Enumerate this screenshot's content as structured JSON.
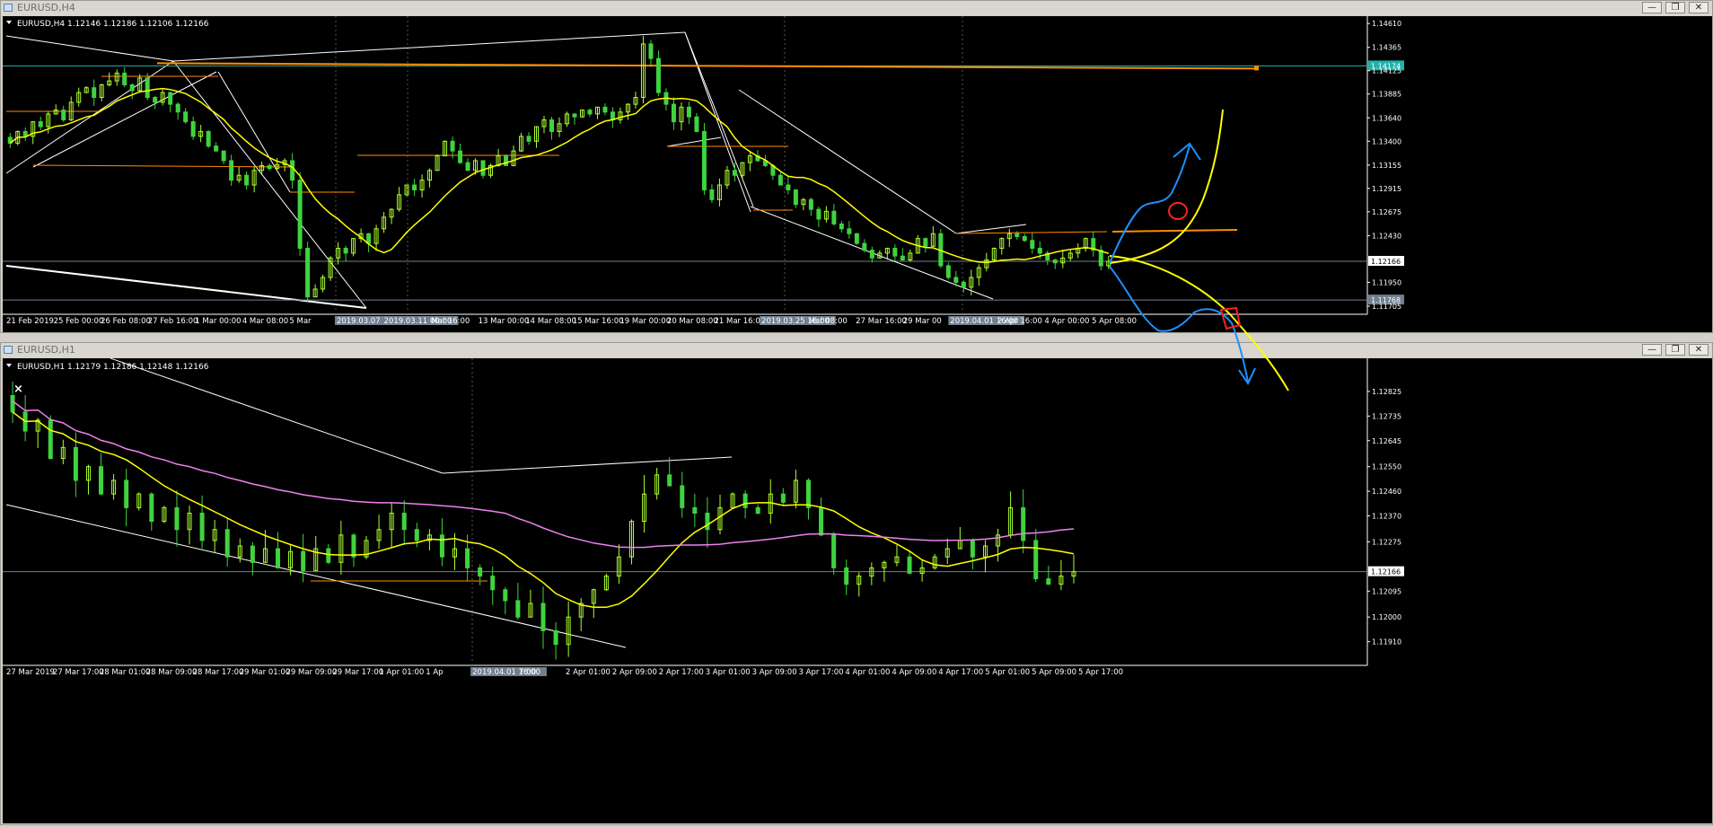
{
  "window_h4": {
    "title": "EURUSD,H4",
    "info": "EURUSD,H4  1.12146 1.12186 1.12106 1.12166",
    "buttons": [
      "—",
      "❐",
      "✕"
    ]
  },
  "window_h1": {
    "title": "EURUSD,H1",
    "info": "EURUSD,H1  1.12179 1.12186 1.12148 1.12166",
    "buttons": [
      "—",
      "❐",
      "✕"
    ]
  },
  "colors": {
    "background": "#000000",
    "bull_candle": "#adff2f",
    "bear_candle": "#3fd33f",
    "ma_yellow": "#ffff00",
    "ma_violet": "#ee82ee",
    "trendline": "#ffffff",
    "level_orange": "#ff8c00",
    "current_price_line": "#708090",
    "sketch_blue": "#1e90ff",
    "sketch_red": "#ff2020"
  },
  "chart_data": [
    {
      "type": "candlestick",
      "symbol": "EURUSD",
      "timeframe": "H4",
      "ohlc": {
        "open": 1.12146,
        "high": 1.12186,
        "low": 1.12106,
        "close": 1.12166
      },
      "ylim": [
        1.1164,
        1.1463
      ],
      "y_ticks": [
        "1.14610",
        "1.14365",
        "1.14174",
        "1.14125",
        "1.13885",
        "1.13640",
        "1.13400",
        "1.13155",
        "1.12915",
        "1.12675",
        "1.12430",
        "1.12166",
        "1.11950",
        "1.11768",
        "1.11705"
      ],
      "current_price": "1.12166",
      "marked_level": "1.14174",
      "lower_level": "1.11768",
      "x_ticks": [
        "21 Feb 2019",
        "25 Feb 00:00",
        "26 Feb 08:00",
        "27 Feb 16:00",
        "1 Mar 00:00",
        "4 Mar 08:00",
        "5 Mar",
        "2019.03.07 00:00",
        "2019.03.11 00:00",
        "Mar 16:00",
        "13 Mar 00:00",
        "14 Mar 08:00",
        "15 Mar 16:00",
        "19 Mar 00:00",
        "20 Mar 08:00",
        "21 Mar 16:00",
        "2019.03.25 16:00",
        "Mar 08:00",
        "27 Mar 16:00",
        "29 Mar 00",
        "2019.04.01 16:00",
        "2 Apr 16:00",
        "4 Apr 00:00",
        "5 Apr 08:00"
      ],
      "highlighted_x_ticks": [
        "2019.03.07 00:00",
        "2019.03.11 00:00",
        "2019.03.25 16:00",
        "2019.04.01 16:00"
      ],
      "closes": [
        1.1338,
        1.135,
        1.1345,
        1.136,
        1.1355,
        1.1368,
        1.1372,
        1.1362,
        1.138,
        1.139,
        1.1395,
        1.1385,
        1.1398,
        1.1402,
        1.141,
        1.1398,
        1.1392,
        1.1405,
        1.1385,
        1.138,
        1.139,
        1.1378,
        1.137,
        1.136,
        1.1345,
        1.135,
        1.1335,
        1.133,
        1.132,
        1.13,
        1.1305,
        1.1295,
        1.131,
        1.1315,
        1.1312,
        1.1316,
        1.132,
        1.13,
        1.123,
        1.118,
        1.1188,
        1.12,
        1.122,
        1.123,
        1.1225,
        1.124,
        1.1245,
        1.1235,
        1.125,
        1.1262,
        1.127,
        1.1285,
        1.1295,
        1.129,
        1.13,
        1.131,
        1.1325,
        1.134,
        1.133,
        1.1318,
        1.131,
        1.132,
        1.1305,
        1.1315,
        1.1325,
        1.1315,
        1.133,
        1.1345,
        1.134,
        1.1355,
        1.1362,
        1.135,
        1.1358,
        1.1368,
        1.1365,
        1.1372,
        1.1368,
        1.1375,
        1.137,
        1.1362,
        1.137,
        1.1378,
        1.1385,
        1.144,
        1.1425,
        1.139,
        1.1378,
        1.136,
        1.1375,
        1.1365,
        1.135,
        1.129,
        1.128,
        1.1295,
        1.131,
        1.1305,
        1.1318,
        1.1325,
        1.132,
        1.1315,
        1.1305,
        1.1295,
        1.129,
        1.1275,
        1.128,
        1.127,
        1.126,
        1.1268,
        1.1255,
        1.125,
        1.1245,
        1.1235,
        1.1228,
        1.122,
        1.1225,
        1.123,
        1.1222,
        1.1218,
        1.1225,
        1.124,
        1.1232,
        1.1245,
        1.1212,
        1.12,
        1.1195,
        1.119,
        1.12,
        1.121,
        1.1218,
        1.123,
        1.124,
        1.1245,
        1.1242,
        1.1238,
        1.123,
        1.1225,
        1.1218,
        1.1215,
        1.122,
        1.1225,
        1.123,
        1.124,
        1.1228,
        1.1212,
        1.12166
      ]
    },
    {
      "type": "candlestick",
      "symbol": "EURUSD",
      "timeframe": "H1",
      "ohlc": {
        "open": 1.12179,
        "high": 1.12186,
        "low": 1.12148,
        "close": 1.12166
      },
      "ylim": [
        1.1183,
        1.1292
      ],
      "y_ticks": [
        "1.12825",
        "1.12735",
        "1.12645",
        "1.12550",
        "1.12460",
        "1.12370",
        "1.12275",
        "1.12166",
        "1.12095",
        "1.12000",
        "1.11910"
      ],
      "current_price": "1.12166",
      "x_ticks": [
        "27 Mar 2019",
        "27 Mar 17:00",
        "28 Mar 01:00",
        "28 Mar 09:00",
        "28 Mar 17:00",
        "29 Mar 01:00",
        "29 Mar 09:00",
        "29 Mar 17:00",
        "1 Apr 01:00",
        "1 Ap",
        "2019.04.01 16:00",
        "7:00",
        "2 Apr 01:00",
        "2 Apr 09:00",
        "2 Apr 17:00",
        "3 Apr 01:00",
        "3 Apr 09:00",
        "3 Apr 17:00",
        "4 Apr 01:00",
        "4 Apr 09:00",
        "4 Apr 17:00",
        "5 Apr 01:00",
        "5 Apr 09:00",
        "5 Apr 17:00"
      ],
      "highlighted_x_ticks": [
        "2019.04.01 16:00"
      ],
      "closes": [
        1.1275,
        1.1268,
        1.1272,
        1.1258,
        1.1262,
        1.125,
        1.1255,
        1.1245,
        1.125,
        1.124,
        1.1245,
        1.1235,
        1.124,
        1.1232,
        1.1238,
        1.1228,
        1.1232,
        1.1222,
        1.1226,
        1.122,
        1.1225,
        1.1218,
        1.1224,
        1.1217,
        1.1225,
        1.122,
        1.123,
        1.1222,
        1.1228,
        1.1232,
        1.1238,
        1.1232,
        1.1228,
        1.123,
        1.1222,
        1.1225,
        1.1218,
        1.1215,
        1.121,
        1.1206,
        1.12,
        1.1205,
        1.1195,
        1.119,
        1.12,
        1.1205,
        1.121,
        1.1215,
        1.1222,
        1.1235,
        1.1245,
        1.1252,
        1.1248,
        1.124,
        1.1238,
        1.1232,
        1.124,
        1.1245,
        1.124,
        1.1238,
        1.1245,
        1.1242,
        1.125,
        1.124,
        1.123,
        1.1218,
        1.1212,
        1.1215,
        1.1218,
        1.122,
        1.1222,
        1.1216,
        1.1218,
        1.1222,
        1.1225,
        1.1228,
        1.1222,
        1.1226,
        1.123,
        1.124,
        1.1228,
        1.1214,
        1.1212,
        1.1215,
        1.12166
      ],
      "moving_averages": [
        "yellow",
        "violet"
      ]
    }
  ]
}
